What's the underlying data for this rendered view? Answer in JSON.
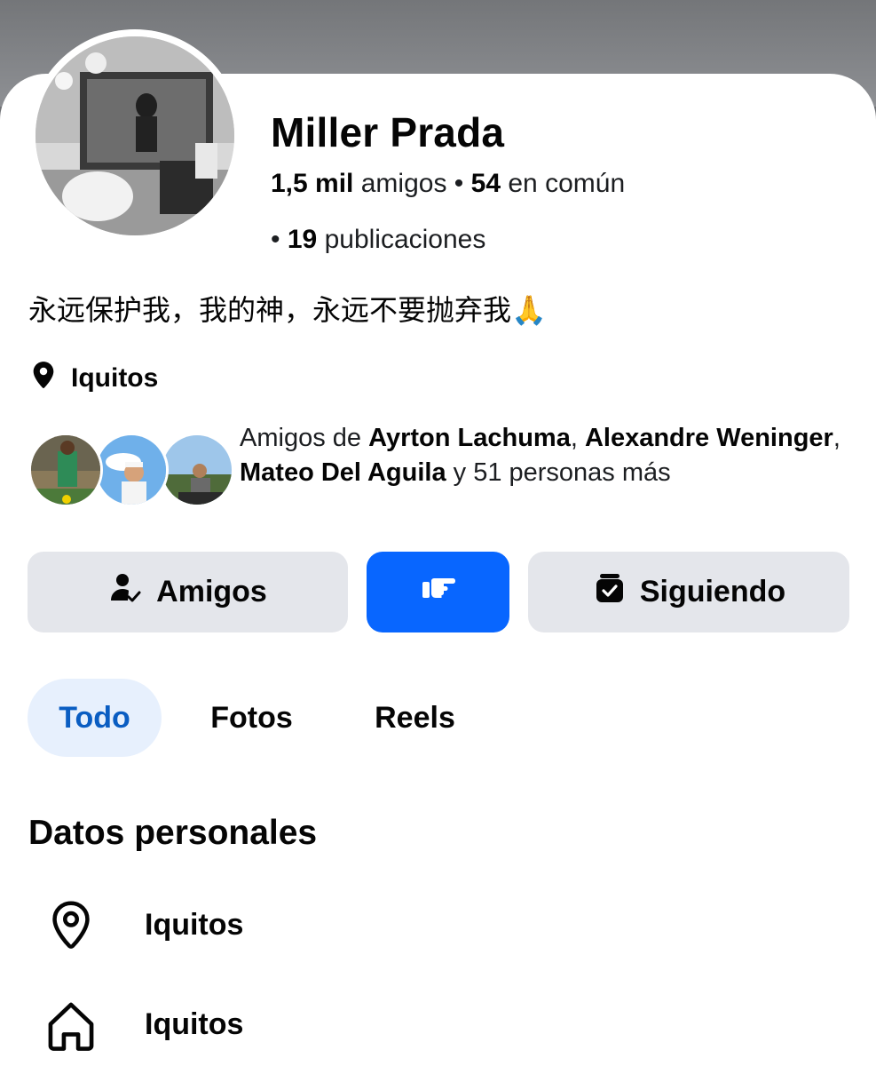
{
  "profile": {
    "name": "Miller Prada",
    "friends_count": "1,5 mil",
    "friends_label": "amigos",
    "separator": "•",
    "mutual_count": "54",
    "mutual_label": "en común",
    "posts_count": "19",
    "posts_label": "publicaciones",
    "bio": "永远保护我，我的神，永远不要抛弃我🙏",
    "location": "Iquitos"
  },
  "mutual_friends": {
    "prefix": "Amigos de",
    "friend1": "Ayrton Lachuma",
    "friend2": "Alexandre Weninger",
    "friend3": "Mateo Del Aguila",
    "suffix": "y 51 personas más"
  },
  "actions": {
    "friends_label": "Amigos",
    "following_label": "Siguiendo"
  },
  "tabs": [
    {
      "label": "Todo",
      "active": true
    },
    {
      "label": "Fotos",
      "active": false
    },
    {
      "label": "Reels",
      "active": false
    }
  ],
  "personal_data": {
    "title": "Datos personales",
    "items": [
      {
        "icon": "location-pin-icon",
        "label": "Iquitos"
      },
      {
        "icon": "home-icon",
        "label": "Iquitos"
      }
    ]
  },
  "colors": {
    "accent_blue": "#0866ff",
    "tab_active_bg": "#e7f0fd",
    "tab_active_text": "#0a5dc2",
    "button_grey": "#e4e6eb"
  }
}
